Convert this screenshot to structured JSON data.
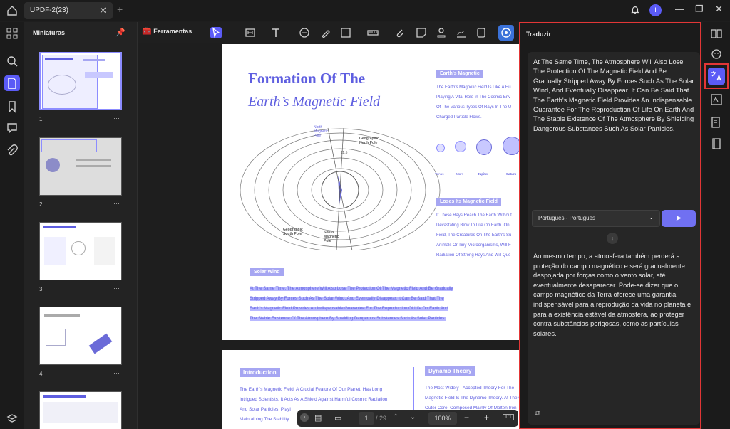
{
  "app": {
    "tab_title": "UPDF-2(23)",
    "tab_close": "✕",
    "new_tab": "+",
    "avatar_initial": "I"
  },
  "thumbnails": {
    "title": "Miniaturas",
    "pages": [
      {
        "number": "1",
        "more": "···"
      },
      {
        "number": "2",
        "more": "···"
      },
      {
        "number": "3",
        "more": "···"
      },
      {
        "number": "4",
        "more": "···"
      }
    ]
  },
  "toolbar": {
    "tools_label": "Ferramentas"
  },
  "document": {
    "page1": {
      "title_line1": "Formation Of The",
      "title_line2": "Earth’s Magnetic Field",
      "section_magnetic": "Earth’s Magnetic",
      "magnetic_text": [
        "The Earth's Magnetic Field Is Like A Hu",
        "Playing A Vital Role In The Cosmic Env",
        "Of The Various Types Of Rays In The U",
        "Charged Particle Flows."
      ],
      "planet_labels": [
        "Venus",
        "Mars",
        "Jupiter",
        "Saturn"
      ],
      "section_loses": "Loses Its Magnetic Field",
      "loses_text": [
        "If These Rays Reach The Earth Without",
        "Devastating Blow To Life On Earth. On",
        "Field, The Creatures On The Earth's Su",
        "Animals Or Tiny Microorganisms, Will F",
        "Radiation Of Strong Rays And Will Que"
      ],
      "diagram_labels": {
        "north_magnetic_pole": "North Magnetic Pole",
        "geographic_north_pole": "Geographic North Pole",
        "geographic_south_pole": "Geographic South Pole",
        "south_magnetic_pole": "South Magnetic Pole",
        "angle": "11.5"
      },
      "section_solar": "Solar Wind",
      "solar_text": [
        "At The Same Time, The Atmosphere Will Also Lose The Protection Of The Magnetic Field And Be Gradually",
        "Stripped Away By Forces Such As The Solar Wind, And Eventually Disappear. It Can Be Said That The",
        "Earth's Magnetic Field Provides An Indispensable Guarantee For The Reproduction Of Life On Earth And",
        "The Stable Existence Of The Atmosphere By Shielding Dangerous Substances Such As Solar Particles."
      ]
    },
    "page2": {
      "section_intro": "Introduction",
      "intro_text": [
        "The Earth's Magnetic Field, A Crucial Feature Of Our Planet, Has Long",
        "Intrigued Scientists. It Acts As A Shield Against Harmful Cosmic Radiation",
        "And Solar Particles, Playi",
        "Maintaining The Stability"
      ],
      "section_dynamo": "Dynamo Theory",
      "dynamo_text": [
        "The Most Widely - Accepted Theory For The",
        "Magnetic Field Is The Dynamo Theory. At The Core Of This The",
        "Outer Core, Composed Mainly Of Molten Iron"
      ]
    }
  },
  "navbar": {
    "page_current": "1",
    "page_total": "/ 29",
    "zoom": "100%",
    "fit_label": "1:1"
  },
  "translate": {
    "title": "Traduzir",
    "source_text": "At The Same Time, The Atmosphere Will Also Lose The Protection Of The Magnetic Field And Be Gradually Stripped Away By Forces Such As The Solar Wind, And Eventually Disappear. It Can Be Said That The Earth's Magnetic Field Provides An Indispensable Guarantee For The Reproduction Of Life On Earth And The Stable Existence Of The Atmosphere By Shielding Dangerous Substances Such As Solar Particles.",
    "language": "Português - Português",
    "translated_text": "Ao mesmo tempo, a atmosfera também perderá a proteção do campo magnético e será gradualmente despojada por forças como o vento solar, até eventualmente desaparecer. Pode-se dizer que o campo magnético da Terra oferece uma garantia indispensável para a reprodução da vida no planeta e para a existência estável da atmosfera, ao proteger contra substâncias perigosas, como as partículas solares."
  },
  "colors": {
    "accent": "#5b5bf6",
    "highlight_border": "#e23636",
    "doc_purple": "#5e5ee0"
  }
}
